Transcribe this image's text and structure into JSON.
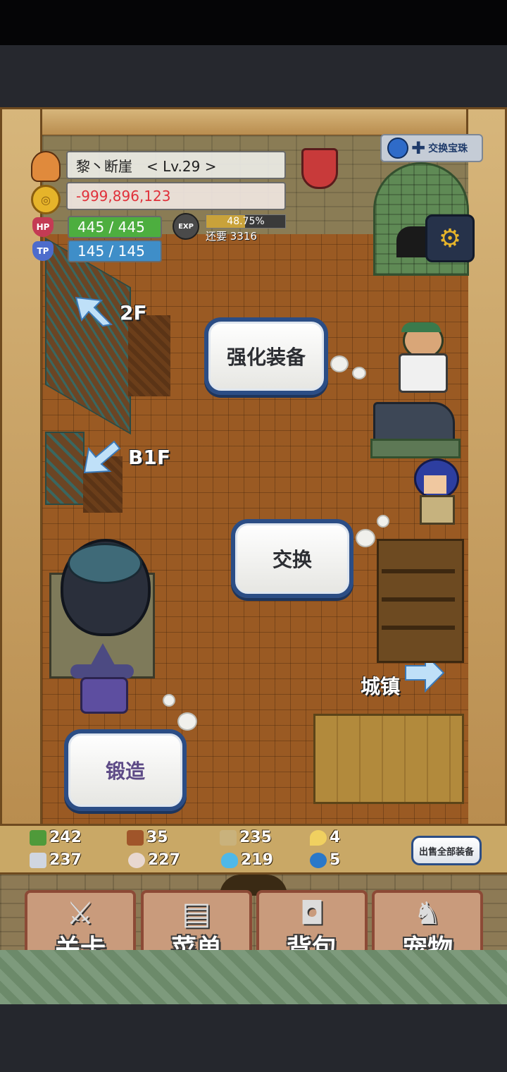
{
  "player": {
    "name_level": "黎丶断崖　< Lv.29 >",
    "gold": "-999,896,123",
    "hp_label": "HP",
    "hp": "445 / 445",
    "tp_label": "TP",
    "tp": "145 / 145",
    "exp_label": "EXP",
    "exp_percent": "48.75%",
    "exp_progress": 0.4875,
    "exp_remaining": "还要 3316"
  },
  "top_right": {
    "exchange_badge": "交换宝珠"
  },
  "locations": {
    "upstairs": "2F",
    "downstairs": "B1F",
    "town": "城镇"
  },
  "actions": {
    "enhance": "强化装备",
    "exchange": "交换",
    "forge": "锻造"
  },
  "resources": [
    {
      "name": "herb",
      "value": "242",
      "color": "#4f9a3a"
    },
    {
      "name": "wood",
      "value": "35",
      "color": "#a0552a"
    },
    {
      "name": "plank",
      "value": "235",
      "color": "#c9b27c"
    },
    {
      "name": "drop",
      "value": "4",
      "color": "#f0d060"
    },
    {
      "name": "iron",
      "value": "237",
      "color": "#d0d6e0"
    },
    {
      "name": "stone",
      "value": "227",
      "color": "#e8d8d0"
    },
    {
      "name": "flame",
      "value": "219",
      "color": "#4fb8e8"
    },
    {
      "name": "orb",
      "value": "5",
      "color": "#2a78c8"
    }
  ],
  "sell_all": "出售全部装备",
  "nav": {
    "stage": "关卡",
    "menu": "菜单",
    "bag": "背包",
    "pet": "宠物"
  }
}
